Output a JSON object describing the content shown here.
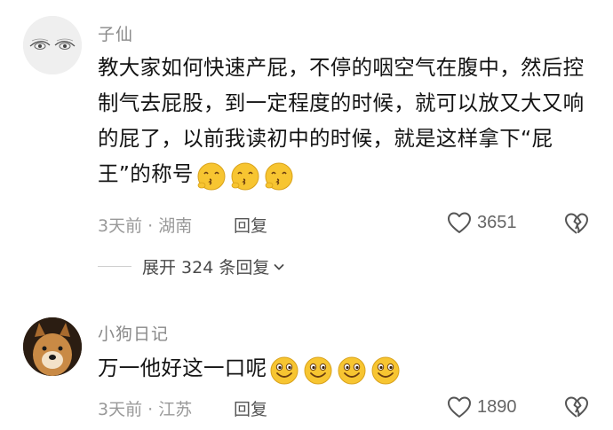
{
  "comments": [
    {
      "username": "子仙",
      "text": "教大家如何快速产屁，不停的咽空气在腹中，然后控制气去屁股，到一定程度的时候，就可以放又大又响的屁了，以前我读初中的时候，就是这样拿下“屁王”的称号",
      "emojis": [
        "kiss-face-emoji",
        "kiss-face-emoji",
        "kiss-face-emoji"
      ],
      "time": "3天前",
      "separator": "·",
      "location": "湖南",
      "reply_label": "回复",
      "likes": "3651",
      "expand_label": "展开 324 条回复"
    },
    {
      "username": "小狗日记",
      "text": "万一他好这一口呢",
      "emojis": [
        "smile-face-emoji",
        "smile-face-emoji",
        "smile-face-emoji",
        "smile-face-emoji"
      ],
      "time": "3天前",
      "separator": "·",
      "location": "江苏",
      "reply_label": "回复",
      "likes": "1890"
    }
  ],
  "colors": {
    "meta": "#999999",
    "username": "#8a8a8a",
    "text": "#141414",
    "emoji_yellow": "#f7c531"
  },
  "icons": {
    "like": "heart-outline-icon",
    "dislike": "broken-heart-icon",
    "expand": "chevron-down-icon"
  }
}
